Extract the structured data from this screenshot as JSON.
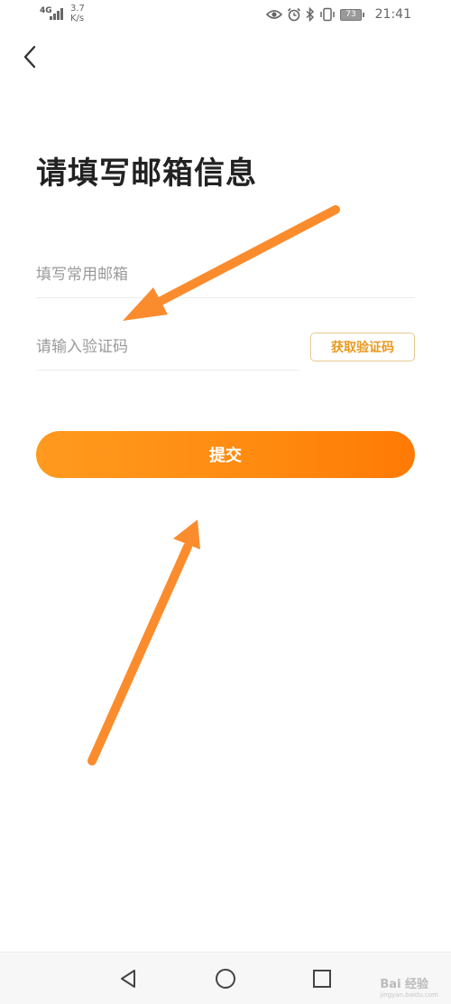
{
  "status_bar": {
    "network": "4G",
    "speed_value": "3.7",
    "speed_unit": "K/s",
    "battery": "73",
    "time": "21:41",
    "icons": [
      "eye-icon",
      "alarm-icon",
      "bluetooth-icon",
      "vibrate-icon",
      "battery-icon"
    ]
  },
  "header": {
    "back_icon": "chevron-left-icon"
  },
  "form": {
    "title": "请填写邮箱信息",
    "email_placeholder": "填写常用邮箱",
    "code_placeholder": "请输入验证码",
    "get_code_label": "获取验证码",
    "submit_label": "提交"
  },
  "annotations": {
    "arrow_color": "#fb8c2e"
  },
  "nav_bar": {
    "icons": [
      "nav-back-icon",
      "nav-home-icon",
      "nav-recent-icon"
    ]
  },
  "watermark": {
    "text": "Bai 经验",
    "sub": "jingyan.baidu.com"
  },
  "colors": {
    "accent": "#ff8a10",
    "code_button_text": "#e89a1e",
    "code_button_border": "#e6c98f"
  }
}
